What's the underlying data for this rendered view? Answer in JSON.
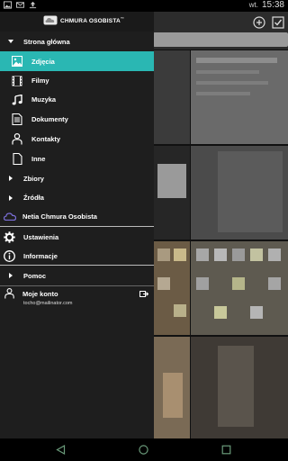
{
  "status_bar": {
    "day": "wt.",
    "time": "15:38"
  },
  "drawer": {
    "brand": "CHMURA OSOBISTA",
    "brand_tm": "™",
    "main_section": "Strona główna",
    "items": [
      {
        "label": "Zdjęcia",
        "icon": "image-icon",
        "selected": true
      },
      {
        "label": "Filmy",
        "icon": "film-icon"
      },
      {
        "label": "Muzyka",
        "icon": "music-note-icon"
      },
      {
        "label": "Dokumenty",
        "icon": "document-icon"
      },
      {
        "label": "Kontakty",
        "icon": "person-icon"
      },
      {
        "label": "Inne",
        "icon": "file-icon"
      }
    ],
    "collections": "Zbiory",
    "sources": "Źródła",
    "cloud_source": "Netia Chmura Osobista",
    "settings": "Ustawienia",
    "info": "Informacje",
    "help": "Pomoc",
    "account": "Moje konto",
    "account_email": "tocho@mailinator.com"
  },
  "colors": {
    "accent": "#2ab7b3",
    "drawer_bg": "#1e1e1e",
    "cloud_icon": "#7b6fd8"
  }
}
